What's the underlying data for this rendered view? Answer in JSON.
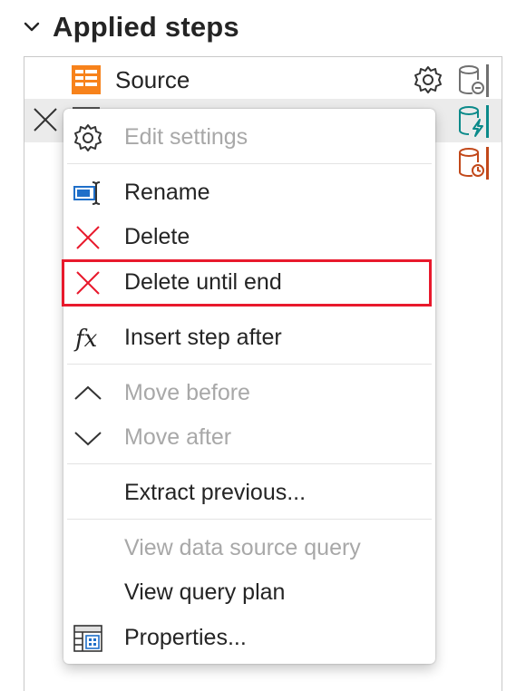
{
  "section": {
    "title": "Applied steps",
    "collapse_icon": "chevron-down-icon"
  },
  "steps": [
    {
      "label": "Source",
      "icon": "table-source-icon",
      "settings_icon": "gear-icon",
      "indicator": "database-minus-icon",
      "indicator_color": "#707070"
    },
    {
      "label": "",
      "icon": "table-step-icon",
      "indicator": "database-lightning-icon",
      "indicator_color": "#0b8a8a",
      "delete_icon": "close-icon"
    },
    {
      "label": "",
      "indicator": "database-clock-icon",
      "indicator_color": "#c2481a"
    }
  ],
  "context_menu": {
    "items": [
      {
        "label": "Edit settings",
        "icon": "gear-icon",
        "enabled": false
      },
      {
        "label": "Rename",
        "icon": "rename-icon",
        "enabled": true
      },
      {
        "label": "Delete",
        "icon": "delete-x-icon",
        "enabled": true
      },
      {
        "label": "Delete until end",
        "icon": "delete-x-icon",
        "enabled": true,
        "highlighted": true
      },
      {
        "label": "Insert step after",
        "icon": "fx-icon",
        "enabled": true
      },
      {
        "label": "Move before",
        "icon": "chevron-up-icon",
        "enabled": false
      },
      {
        "label": "Move after",
        "icon": "chevron-down-icon",
        "enabled": false
      },
      {
        "label": "Extract previous...",
        "enabled": true
      },
      {
        "label": "View data source query",
        "enabled": false
      },
      {
        "label": "View query plan",
        "enabled": true
      },
      {
        "label": "Properties...",
        "icon": "properties-icon",
        "enabled": true
      }
    ]
  },
  "colors": {
    "accent_orange": "#f7821b",
    "delete_red": "#e8192c",
    "highlight": "#e8192c",
    "disabled_text": "#a8a8a8"
  }
}
